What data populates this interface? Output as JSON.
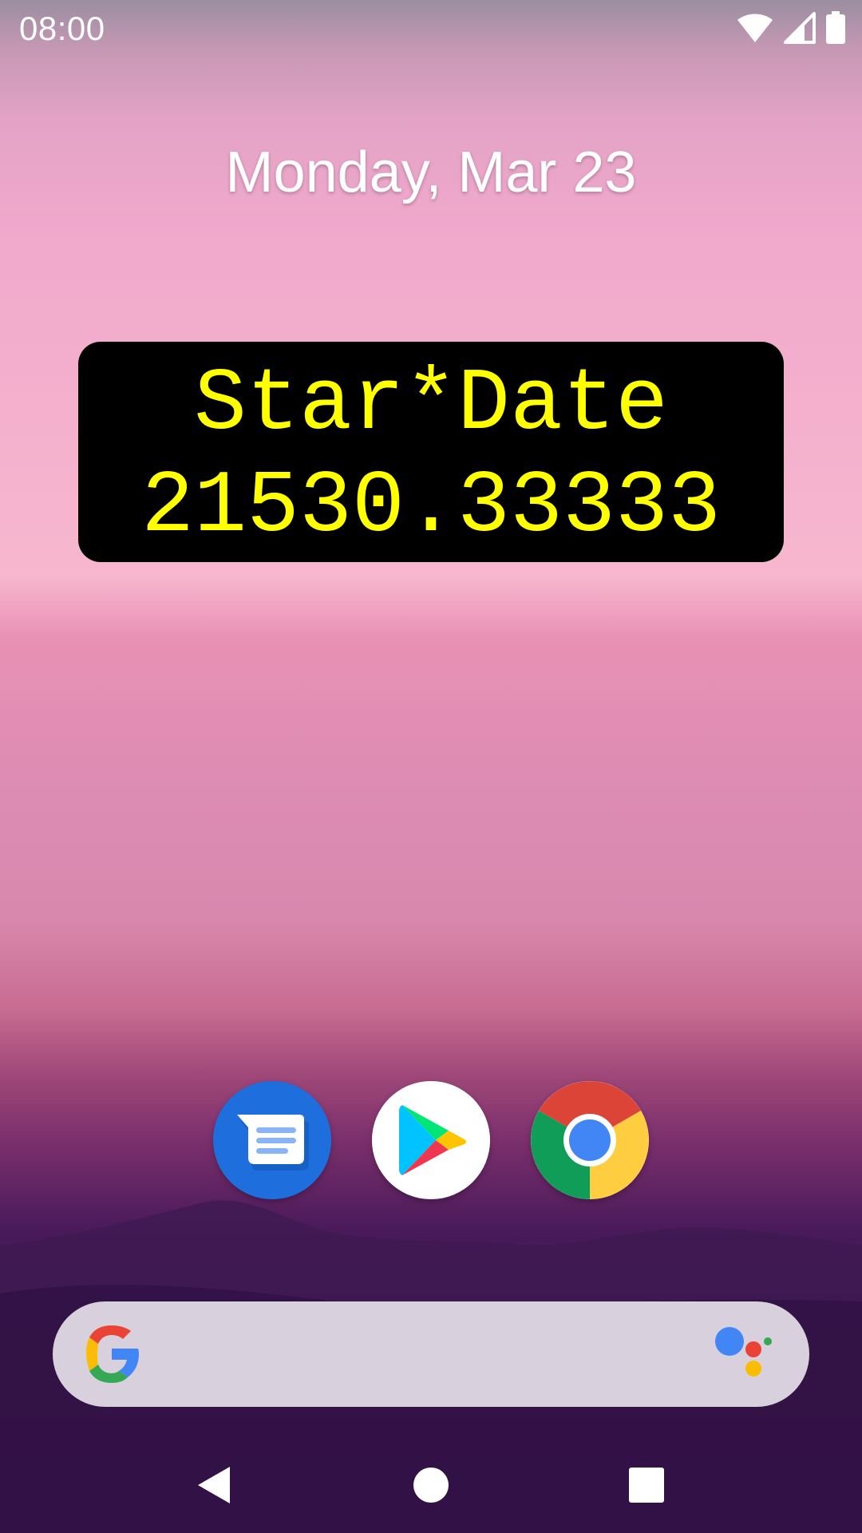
{
  "status_bar": {
    "time": "08:00",
    "icons": [
      "wifi-icon",
      "cell-signal-icon",
      "battery-icon"
    ]
  },
  "home": {
    "date": "Monday, Mar 23"
  },
  "widget": {
    "label": "Star*Date",
    "value": "21530.33333",
    "text_color": "#ffff00",
    "background": "#000000"
  },
  "dock": {
    "apps": [
      "messages-icon",
      "play-store-icon",
      "chrome-icon"
    ]
  },
  "search": {
    "icons": [
      "google-g-icon",
      "google-assistant-icon"
    ]
  },
  "nav": {
    "buttons": [
      "back-icon",
      "home-icon",
      "recents-icon"
    ]
  }
}
